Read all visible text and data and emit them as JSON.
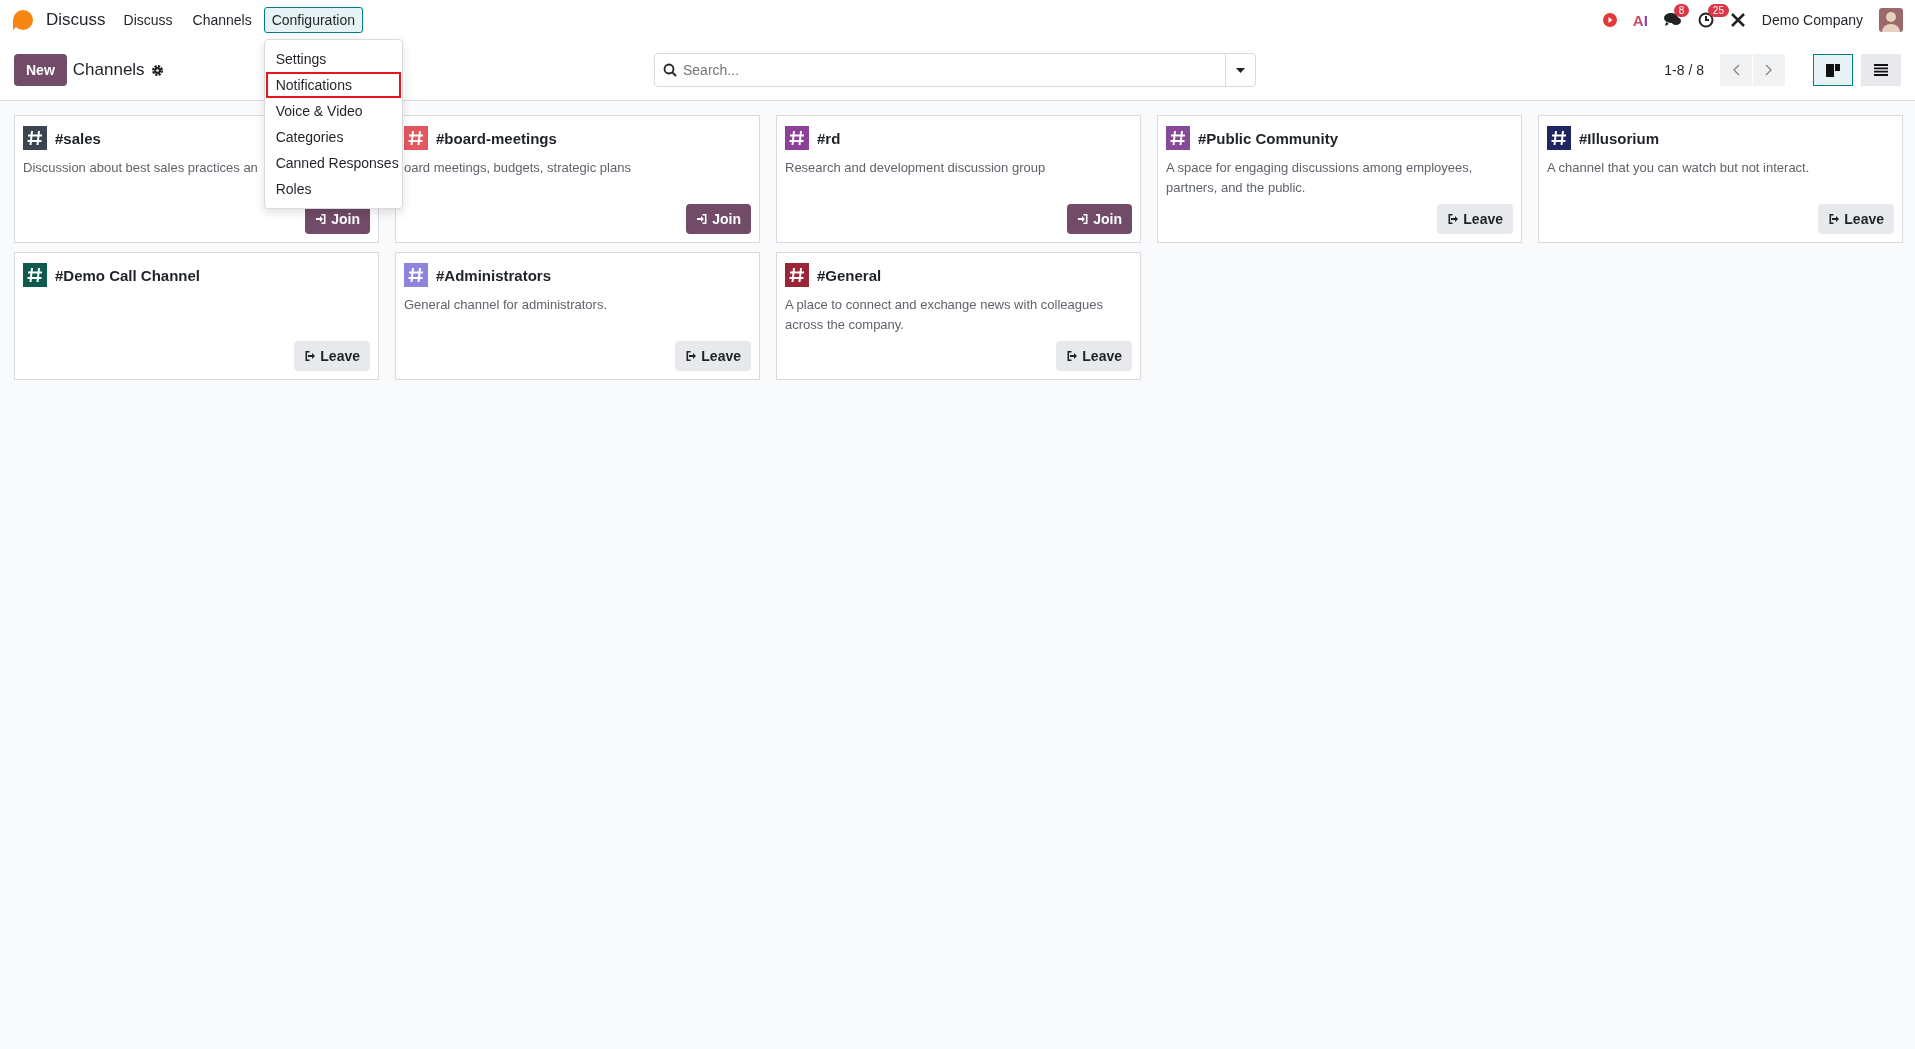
{
  "app": {
    "name": "Discuss"
  },
  "nav": [
    {
      "label": "Discuss",
      "selected": false
    },
    {
      "label": "Channels",
      "selected": false
    },
    {
      "label": "Configuration",
      "selected": true
    }
  ],
  "menu": [
    {
      "label": "Settings",
      "highlighted": false
    },
    {
      "label": "Notifications",
      "highlighted": true
    },
    {
      "label": "Voice & Video",
      "highlighted": false
    },
    {
      "label": "Categories",
      "highlighted": false
    },
    {
      "label": "Canned Responses",
      "highlighted": false
    },
    {
      "label": "Roles",
      "highlighted": false
    }
  ],
  "systray": {
    "ai_label": "AI",
    "chat_badge": "8",
    "activity_badge": "25",
    "company": "Demo Company"
  },
  "control_panel": {
    "new_button": "New",
    "title": "Channels",
    "search": {
      "placeholder": "Search..."
    },
    "pager": "1-8 / 8",
    "views": [
      {
        "kind": "kanban",
        "selected": true
      },
      {
        "kind": "list",
        "selected": false
      }
    ]
  },
  "channels": [
    {
      "name": "#sales",
      "color": "#3d4451",
      "description": "Discussion about best sales practices an",
      "action": {
        "kind": "join",
        "label": "Join"
      }
    },
    {
      "name": "#board-meetings",
      "color": "#e4575f",
      "description": "oard meetings, budgets, strategic plans",
      "action": {
        "kind": "join",
        "label": "Join"
      }
    },
    {
      "name": "#rd",
      "color": "#8a4196",
      "description": "Research and development discussion group",
      "action": {
        "kind": "join",
        "label": "Join"
      }
    },
    {
      "name": "#Public Community",
      "color": "#874a99",
      "description": "A space for engaging discussions among employees, partners, and the public.",
      "action": {
        "kind": "leave",
        "label": "Leave"
      }
    },
    {
      "name": "#Illusorium",
      "color": "#1f2760",
      "description": "A channel that you can watch but not interact.",
      "action": {
        "kind": "leave",
        "label": "Leave"
      }
    },
    {
      "name": "#Demo Call Channel",
      "color": "#0e5a4f",
      "action": {
        "kind": "leave",
        "label": "Leave"
      }
    },
    {
      "name": "#Administrators",
      "color": "#8b86dc",
      "description": "General channel for administrators.",
      "action": {
        "kind": "leave",
        "label": "Leave"
      }
    },
    {
      "name": "#General",
      "color": "#9a2536",
      "description": "A place to connect and exchange news with colleagues across the company.",
      "action": {
        "kind": "leave",
        "label": "Leave"
      }
    }
  ]
}
